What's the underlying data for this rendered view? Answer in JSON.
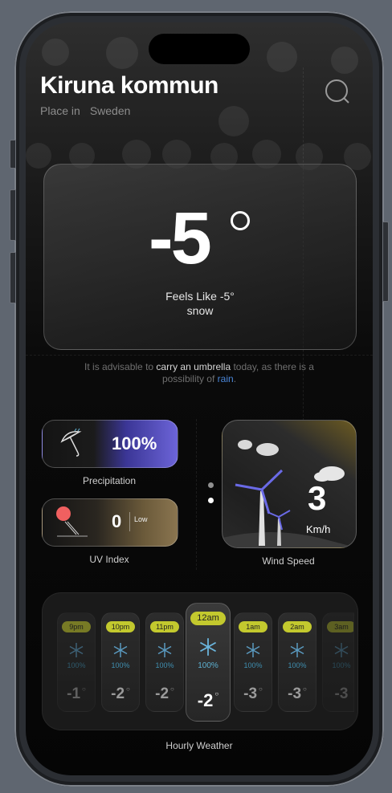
{
  "location": {
    "title": "Kiruna kommun",
    "type": "Place in",
    "country": "Sweden"
  },
  "current": {
    "temp": "-5",
    "feels_like": "Feels Like -5°",
    "condition": "snow"
  },
  "advice": {
    "prefix": "It is advisable to",
    "highlight": "carry an umbrella",
    "middle": "today, as there is a possibility of",
    "rain": "rain",
    "suffix": "."
  },
  "precipitation": {
    "value": "100%",
    "label": "Precipitation"
  },
  "uv": {
    "value": "0",
    "level": "Low",
    "label": "UV Index"
  },
  "wind": {
    "value": "3",
    "unit": "Km/h",
    "label": "Wind Speed"
  },
  "hourly": {
    "label": "Hourly Weather",
    "items": [
      {
        "time": "9pm",
        "pct": "100%",
        "temp": "-1"
      },
      {
        "time": "10pm",
        "pct": "100%",
        "temp": "-2"
      },
      {
        "time": "11pm",
        "pct": "100%",
        "temp": "-2"
      },
      {
        "time": "12am",
        "pct": "100%",
        "temp": "-2"
      },
      {
        "time": "1am",
        "pct": "100%",
        "temp": "-3"
      },
      {
        "time": "2am",
        "pct": "100%",
        "temp": "-3"
      },
      {
        "time": "3am",
        "pct": "100%",
        "temp": "-3"
      }
    ]
  },
  "icons": {
    "search": "search-icon",
    "umbrella": "umbrella-icon",
    "sun": "sun-icon",
    "wind": "wind-turbine-icon",
    "snow": "snowflake-icon"
  },
  "colors": {
    "time_badge": "#c3c92e",
    "precip_accent": "#6c64d8",
    "rain_link": "#4a86d8"
  }
}
